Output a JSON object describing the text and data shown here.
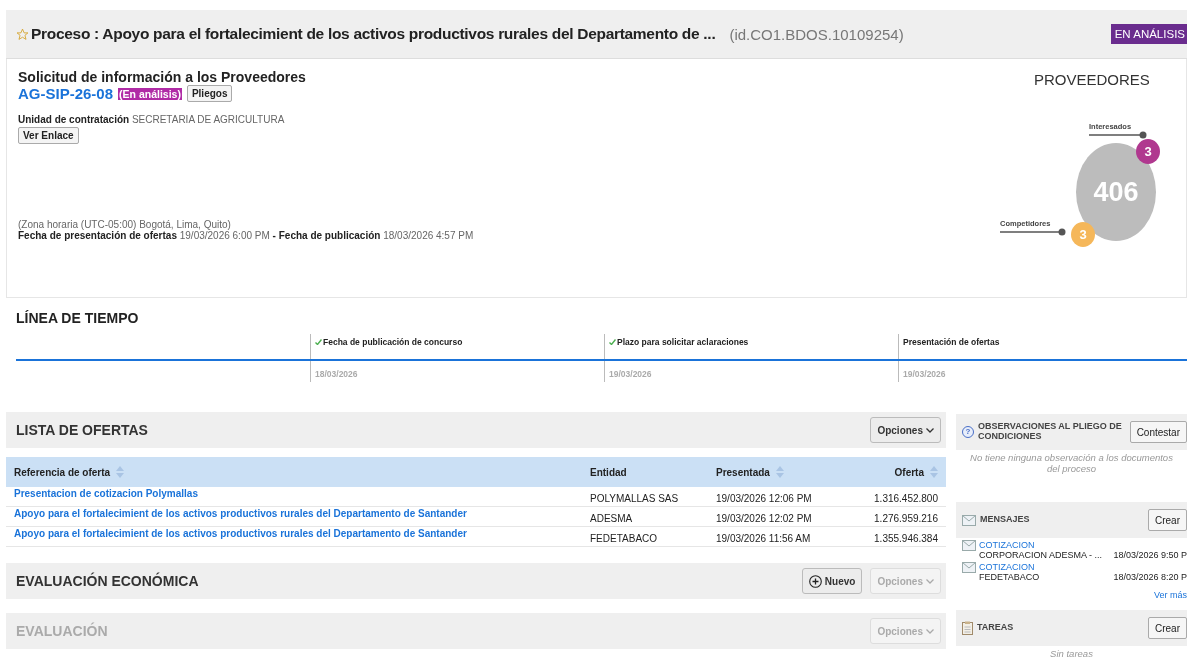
{
  "header": {
    "title": "Proceso : Apoyo para el fortalecimient de los activos productivos rurales del Departamento de ...",
    "id": "(id.CO1.BDOS.10109254)",
    "status": "EN ANÁLISIS",
    "starred": false
  },
  "summary": {
    "type": "Solicitud de información a los Proveedores",
    "reference": "AG-SIP-26-08",
    "status": "(En análisis)",
    "pliegos_button": "Pliegos",
    "unit_label": "Unidad de contratación",
    "unit_value": "SECRETARIA DE AGRICULTURA",
    "link_button": "Ver Enlace",
    "timezone": "(Zona horaria (UTC-05:00) Bogotá, Lima, Quito)",
    "offers_label": "Fecha de presentación de ofertas",
    "offers_value": "19/03/2026 6:00 PM",
    "separator": "-",
    "published_label": "Fecha de publicación",
    "published_value": "18/03/2026 4:57 PM"
  },
  "providers": {
    "title": "PROVEEDORES",
    "total": "406",
    "interested_label": "Interesados",
    "interested": "3",
    "competitors_label": "Competidores",
    "competitors": "3"
  },
  "timeline": {
    "title": "LÍNEA DE TIEMPO",
    "milestones": [
      {
        "label": "Fecha de publicación de concurso",
        "date": "18/03/2026",
        "done": true
      },
      {
        "label": "Plazo para solicitar aclaraciones",
        "date": "19/03/2026",
        "done": true
      },
      {
        "label": "Presentación de ofertas",
        "date": "19/03/2026",
        "done": false
      }
    ]
  },
  "offers": {
    "title": "LISTA DE OFERTAS",
    "options": "Opciones",
    "columns": [
      {
        "label": "Referencia de oferta",
        "sortable": true
      },
      {
        "label": "Entidad",
        "sortable": false
      },
      {
        "label": "Presentada",
        "sortable": true
      },
      {
        "label": "Oferta",
        "sortable": true
      }
    ],
    "rows": [
      {
        "reference": "Presentacion de cotizacion Polymallas",
        "entity": "POLYMALLAS SAS",
        "submitted": "19/03/2026 12:06 PM",
        "amount": "1.316.452.800"
      },
      {
        "reference": "Apoyo para el fortalecimient de los activos productivos rurales del Departamento de Santander",
        "entity": "ADESMA",
        "submitted": "19/03/2026 12:02 PM",
        "amount": "1.276.959.216"
      },
      {
        "reference": "Apoyo para el fortalecimient de los activos productivos rurales del Departamento de Santander",
        "entity": "FEDETABACO",
        "submitted": "19/03/2026 11:56 AM",
        "amount": "1.355.946.384"
      }
    ]
  },
  "sections": [
    {
      "title": "EVALUACIÓN ECONÓMICA",
      "disabled": false,
      "new_button": "Nuevo",
      "options": "Opciones",
      "options_disabled": true
    },
    {
      "title": "EVALUACIÓN",
      "disabled": true,
      "options": "Opciones",
      "options_disabled": true
    }
  ],
  "observations": {
    "help_icon": "?",
    "title": "OBSERVACIONES AL PLIEGO DE CONDICIONES",
    "button": "Contestar",
    "empty": "No tiene ninguna observación a los documentos del proceso"
  },
  "messages": {
    "title": "MENSAJES",
    "button": "Crear",
    "items": [
      {
        "subject": "COTIZACION",
        "sender": "CORPORACION ADESMA - ...",
        "date": "18/03/2026 9:50 P"
      },
      {
        "subject": "COTIZACION",
        "sender": "FEDETABACO",
        "date": "18/03/2026 8:20 P"
      }
    ],
    "more": "Ver más"
  },
  "tasks": {
    "title": "TAREAS",
    "button": "Crear",
    "empty": "Sin tareas"
  }
}
